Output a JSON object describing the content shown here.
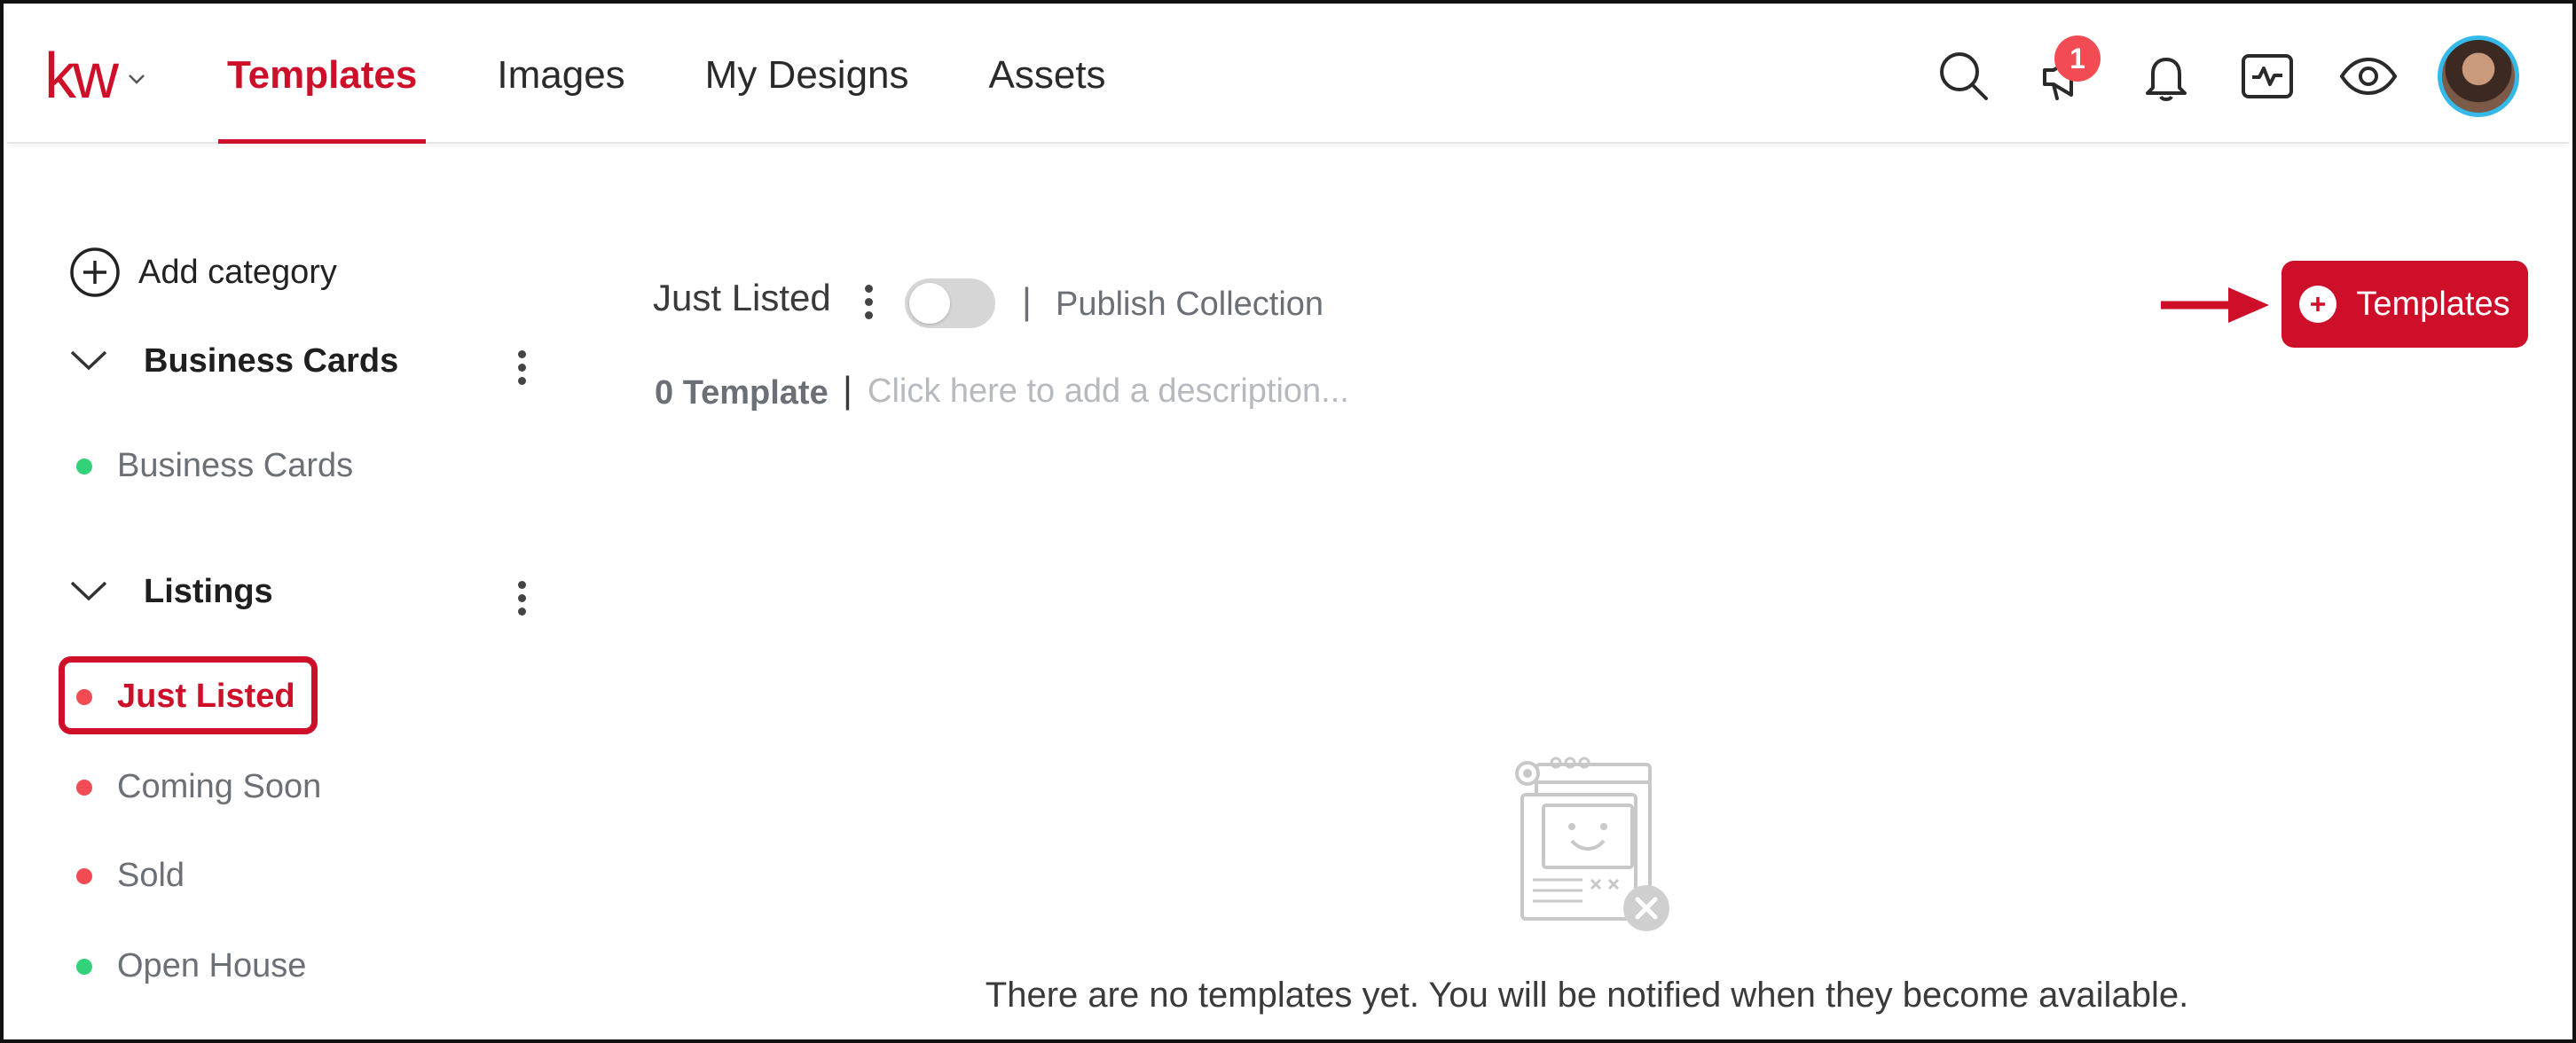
{
  "brand": {
    "logo_text": "kw",
    "accent_color": "#ce0f2a"
  },
  "nav": {
    "tabs": [
      {
        "label": "Templates",
        "active": true
      },
      {
        "label": "Images",
        "active": false
      },
      {
        "label": "My Designs",
        "active": false
      },
      {
        "label": "Assets",
        "active": false
      }
    ]
  },
  "header_icons": {
    "search": "search-icon",
    "announcements": "megaphone-icon",
    "announcements_badge": "1",
    "notifications": "bell-icon",
    "activity": "activity-icon",
    "preview": "eye-icon",
    "avatar": "avatar"
  },
  "sidebar": {
    "add_category_label": "Add category",
    "groups": [
      {
        "title": "Business Cards",
        "items": [
          {
            "label": "Business Cards",
            "status": "green"
          }
        ]
      },
      {
        "title": "Listings",
        "items": [
          {
            "label": "Just Listed",
            "status": "red",
            "selected": true
          },
          {
            "label": "Coming Soon",
            "status": "red"
          },
          {
            "label": "Sold",
            "status": "red"
          },
          {
            "label": "Open House",
            "status": "green"
          }
        ]
      }
    ]
  },
  "main": {
    "collection_title": "Just Listed",
    "publish_toggle_on": false,
    "separator": "|",
    "publish_label": "Publish Collection",
    "template_count": "0 Template",
    "description_placeholder": "Click here to add a description...",
    "add_button_label": "Templates",
    "empty_message": "There are no templates yet. You will be notified when they become available."
  },
  "colors": {
    "status_green": "#33d17a",
    "status_red": "#f24b53",
    "toggle_off": "#d6d6d6",
    "avatar_ring": "#35b9e8"
  }
}
